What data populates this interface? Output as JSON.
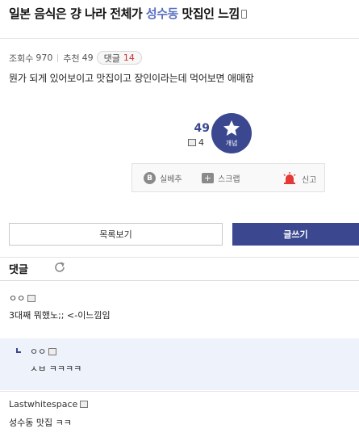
{
  "post": {
    "title_part1": "일본 음식은 걍 나라 전체가 ",
    "title_highlight": "성수동",
    "title_part2": " 맛집인 느낌",
    "views_label": "조회수",
    "views": "970",
    "recommend_label": "추천",
    "recommend": "49",
    "comments_label": "댓글",
    "comments": "14",
    "body": "뭔가 되게 있어보이고 맛집이고 장인이라는데 먹어보면 애매함"
  },
  "vote": {
    "count": "49",
    "sub_count": "4",
    "star_label": "개념"
  },
  "actions": {
    "best": "실베추",
    "scrap": "스크랩",
    "report": "신고"
  },
  "buttons": {
    "list": "목록보기",
    "write": "글쓰기"
  },
  "comments_section": {
    "header": "댓글",
    "items": [
      {
        "author": "ㅇㅇ",
        "text": "3대째 뭐했노;; <-이느낌임"
      },
      {
        "author": "ㅇㅇ",
        "text": "ㅅㅂ ㅋㅋㅋㅋ"
      },
      {
        "author": "Lastwhitespace",
        "text": "성수동 맛집 ㅋㅋ"
      }
    ]
  },
  "colors": {
    "brand": "#3b4890",
    "highlight": "#5a6fc2",
    "comment_count": "#d32f2f",
    "reply_bg": "#eef2fa"
  }
}
